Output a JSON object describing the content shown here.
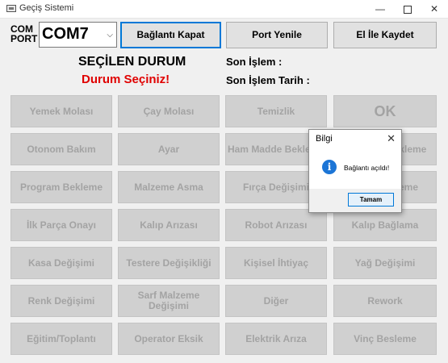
{
  "window": {
    "title": "Geçiş Sistemi",
    "min_icon": "minimize-icon",
    "max_icon": "maximize-icon",
    "close_icon": "close-icon",
    "min_glyph": "—",
    "close_glyph": "✕"
  },
  "com": {
    "label": "COM PORT",
    "selected": "COM7",
    "arrow": "⌵"
  },
  "toolbar": {
    "connect_close": "Bağlantı Kapat",
    "port_refresh": "Port Yenile",
    "manual_save": "El İle Kaydet"
  },
  "status": {
    "selected_title": "SEÇİLEN DURUM",
    "selected_value": "Durum Seçiniz!",
    "last_op_label": "Son İşlem :",
    "last_date_label": "Son İşlem Tarih :"
  },
  "grid_buttons": [
    [
      "Yemek Molası",
      "Çay Molası",
      "Temizlik",
      "OK"
    ],
    [
      "Otonom Bakım",
      "Ayar",
      "Ham Madde Bekleme",
      "Malzeme Bekleme"
    ],
    [
      "Program Bekleme",
      "Malzeme Asma",
      "Fırça Değişimi",
      "Kalıp Bekleme"
    ],
    [
      "İlk Parça Onayı",
      "Kalıp Arızası",
      "Robot Arızası",
      "Kalıp Bağlama"
    ],
    [
      "Kasa Değişimi",
      "Testere Değişikliği",
      "Kişisel İhtiyaç",
      "Yağ Değişimi"
    ],
    [
      "Renk Değişimi",
      "Sarf Malzeme Değişimi",
      "Diğer",
      "Rework"
    ],
    [
      "Eğitim/Toplantı",
      "Operator Eksik",
      "Elektrik Arıza",
      "Vinç Besleme"
    ]
  ],
  "dialog": {
    "title": "Bilgi",
    "message": "Bağlantı açıldı!",
    "ok": "Tamam",
    "icon": "info-icon",
    "info_glyph": "i",
    "close_glyph": "✕"
  },
  "colors": {
    "status_red": "#e00000",
    "focus_blue": "#0078d7",
    "disabled_text": "#a3a3a3"
  }
}
